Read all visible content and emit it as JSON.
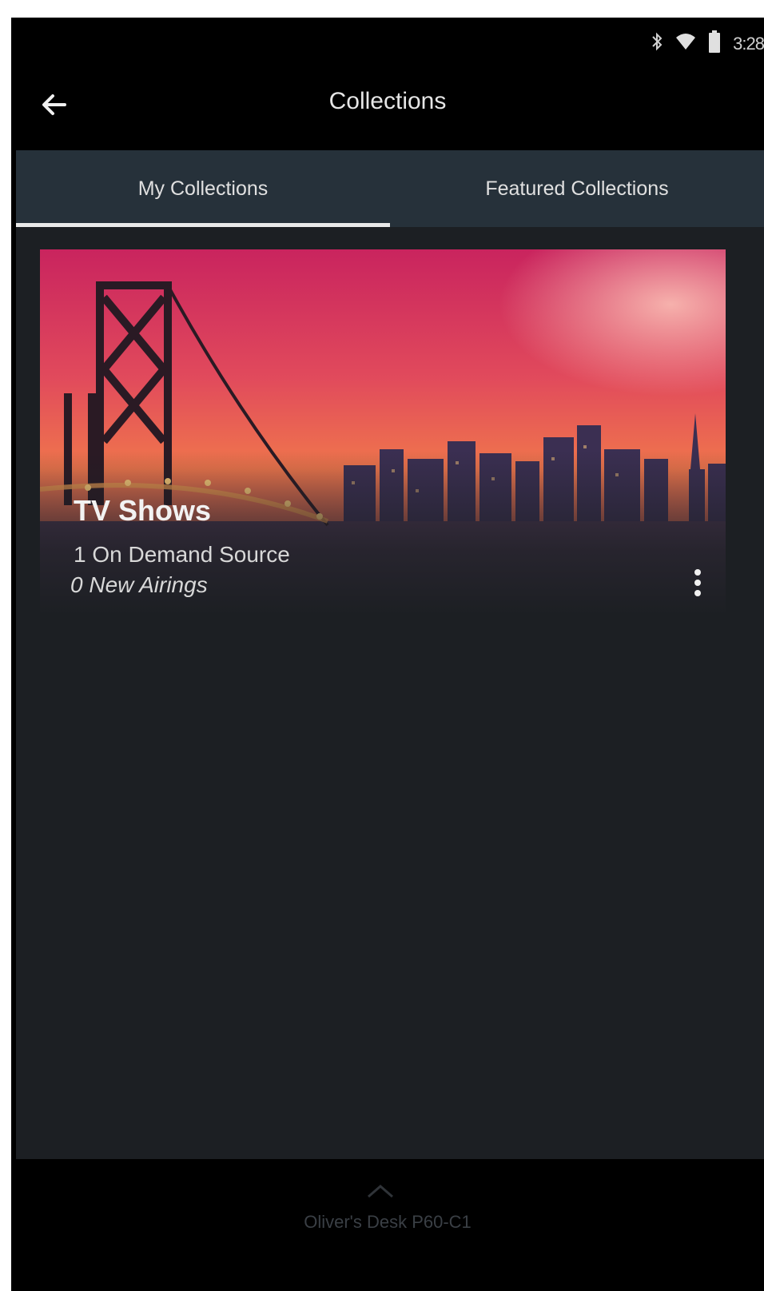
{
  "status_bar": {
    "time": "3:28",
    "icons": [
      "bluetooth-icon",
      "wifi-icon",
      "battery-icon"
    ]
  },
  "app_bar": {
    "title": "Collections",
    "back_icon": "arrow-left-icon"
  },
  "tabs": [
    {
      "label": "My Collections",
      "active": true
    },
    {
      "label": "Featured Collections",
      "active": false
    }
  ],
  "collection_card": {
    "title": "TV Shows",
    "line1": "1 On Demand Source",
    "line2": "0 New Airings",
    "image": "city-bridge-sunset",
    "menu_icon": "more-vert-icon"
  },
  "footer": {
    "device_name": "Oliver's Desk P60-C1",
    "device_sub": "",
    "expand_icon": "chevron-up-icon"
  },
  "colors": {
    "background": "#000000",
    "content_bg": "#1c1f23",
    "tab_bar": "#26313a",
    "tab_indicator": "#e9e9e9",
    "text_primary": "#e6e6e6"
  }
}
